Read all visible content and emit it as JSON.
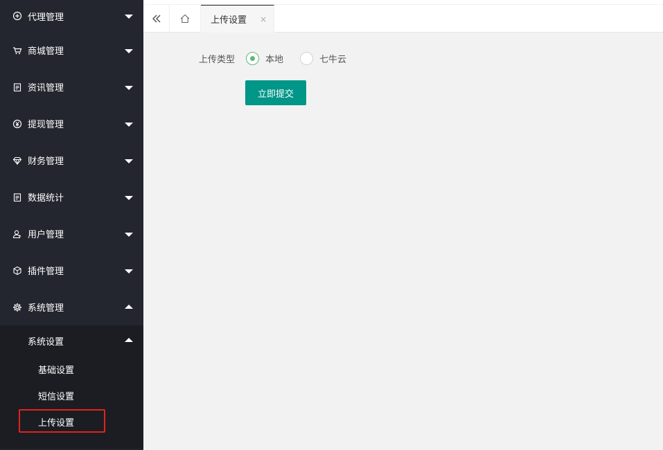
{
  "sidebar": {
    "items": [
      {
        "label": "代理管理",
        "icon": "plus-circle-icon"
      },
      {
        "label": "商城管理",
        "icon": "cart-icon"
      },
      {
        "label": "资讯管理",
        "icon": "clipboard-icon"
      },
      {
        "label": "提现管理",
        "icon": "yen-icon"
      },
      {
        "label": "财务管理",
        "icon": "diamond-icon"
      },
      {
        "label": "数据统计",
        "icon": "clipboard-icon"
      },
      {
        "label": "用户管理",
        "icon": "user-icon"
      },
      {
        "label": "插件管理",
        "icon": "cube-icon"
      },
      {
        "label": "系统管理",
        "icon": "gear-icon"
      }
    ],
    "submenu": {
      "header": "系统设置",
      "items": [
        "基础设置",
        "短信设置",
        "上传设置"
      ]
    }
  },
  "tabs": {
    "active": "上传设置",
    "close_glyph": "×"
  },
  "form": {
    "upload_type_label": "上传类型",
    "options": [
      "本地",
      "七牛云"
    ],
    "selected": "本地",
    "submit_label": "立即提交"
  },
  "colors": {
    "sidebar_bg": "#23262e",
    "submenu_bg": "#1b1d23",
    "accent": "#009688",
    "radio_checked": "#5fb878",
    "highlight_box": "#e3231a"
  }
}
